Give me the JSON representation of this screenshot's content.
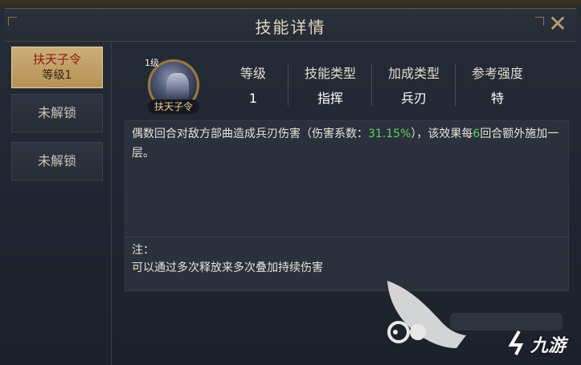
{
  "window": {
    "title": "技能详情",
    "close_icon": "close-icon"
  },
  "tabs": [
    {
      "name": "扶天子令",
      "level": "等级1",
      "active": true
    },
    {
      "label": "未解锁",
      "active": false
    },
    {
      "label": "未解锁",
      "active": false
    }
  ],
  "hero": {
    "level_tag": "1级",
    "name": "扶天子令"
  },
  "stats": [
    {
      "label": "等级",
      "value": "1"
    },
    {
      "label": "技能类型",
      "value": "指挥"
    },
    {
      "label": "加成类型",
      "value": "兵刃"
    },
    {
      "label": "参考强度",
      "value": "特"
    }
  ],
  "description": {
    "part1": "偶数回合对敌方部曲造成兵刃伤害（伤害系数：",
    "coef": "31.15%",
    "part2": "），该效果每",
    "rounds": "6",
    "part3": "回合额外施加一层。",
    "highlight_color": "#5fd05a"
  },
  "note": {
    "label": "注：",
    "text": "可以通过多次释放来多次叠加持续伤害"
  },
  "watermark": {
    "text": "九游"
  }
}
